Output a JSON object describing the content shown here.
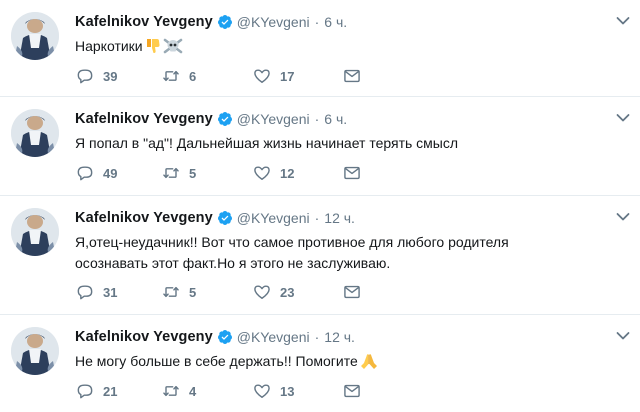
{
  "tweets": [
    {
      "name": "Kafelnikov Yevgeny",
      "handle": "@KYevgeni",
      "time": "6 ч.",
      "text": "Наркотики",
      "emoji": [
        "thumbs-down-icon",
        "skull-crossbones-icon"
      ],
      "replies": "39",
      "retweets": "6",
      "likes": "17"
    },
    {
      "name": "Kafelnikov Yevgeny",
      "handle": "@KYevgeni",
      "time": "6 ч.",
      "text": "Я попал в \"ад\"! Дальнейшая жизнь начинает терять смысл",
      "emoji": [],
      "replies": "49",
      "retweets": "5",
      "likes": "12"
    },
    {
      "name": "Kafelnikov Yevgeny",
      "handle": "@KYevgeni",
      "time": "12 ч.",
      "text_line1": "Я,отец-неудачник!! Вот что самое противное для любого родителя",
      "text_line2": "осознавать этот факт.Но я этого не заслуживаю.",
      "emoji": [],
      "replies": "31",
      "retweets": "5",
      "likes": "23"
    },
    {
      "name": "Kafelnikov Yevgeny",
      "handle": "@KYevgeni",
      "time": "12 ч.",
      "text": "Не могу больше в себе держать!! Помогите",
      "emoji": [
        "folded-hands-icon"
      ],
      "replies": "21",
      "retweets": "4",
      "likes": "13"
    }
  ],
  "separator": "·",
  "colors": {
    "verified": "#1da1f2",
    "muted": "#657786",
    "text": "#14171a",
    "divider": "#e6ecf0"
  },
  "icons": {
    "reply": "speech-bubble-icon",
    "retweet": "retweet-arrows-icon",
    "like": "heart-icon",
    "message": "envelope-icon",
    "menu": "chevron-down-icon"
  }
}
